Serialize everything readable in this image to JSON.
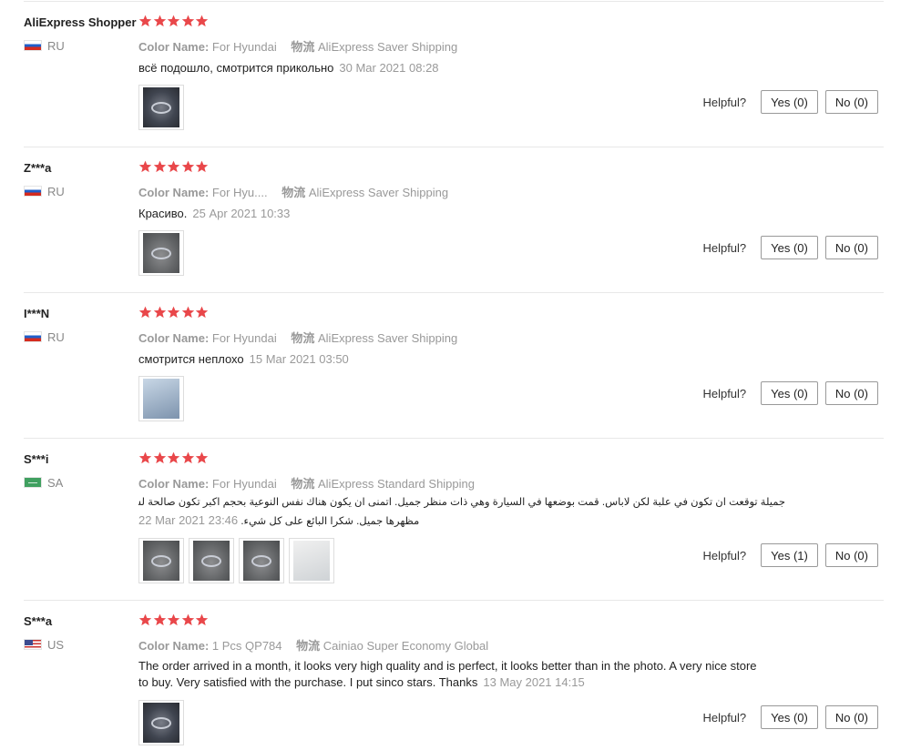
{
  "helpful_label": "Helpful?",
  "colors": {
    "star": "#e9474a",
    "muted": "#999999",
    "divider": "#e8e8e8"
  },
  "reviews": [
    {
      "user": "AliExpress Shopper",
      "country": "RU",
      "rating": 5,
      "color_label": "Color Name:",
      "color_value": "For Hyundai",
      "ship_label": "物流",
      "ship_value": "AliExpress Saver Shipping",
      "text": "всё подошло, смотрится прикольно",
      "date": "30 Mar 2021 08:28",
      "photo_count": 1,
      "yes": "Yes (0)",
      "no": "No (0)"
    },
    {
      "user": "Z***a",
      "country": "RU",
      "rating": 5,
      "color_label": "Color Name:",
      "color_value": "For Hyu....",
      "ship_label": "物流",
      "ship_value": "AliExpress Saver Shipping",
      "text": "Красиво.",
      "date": "25 Apr 2021 10:33",
      "photo_count": 1,
      "yes": "Yes (0)",
      "no": "No (0)"
    },
    {
      "user": "I***N",
      "country": "RU",
      "rating": 5,
      "color_label": "Color Name:",
      "color_value": "For Hyundai",
      "ship_label": "物流",
      "ship_value": "AliExpress Saver Shipping",
      "text": "смотрится неплохо",
      "date": "15 Mar 2021 03:50",
      "photo_count": 1,
      "yes": "Yes (0)",
      "no": "No (0)"
    },
    {
      "user": "S***i",
      "country": "SA",
      "rating": 5,
      "color_label": "Color Name:",
      "color_value": "For Hyundai",
      "ship_label": "物流",
      "ship_value": "AliExpress Standard Shipping",
      "text_line1": "جميلة توقعت ان تكون في علبة لكن لاباس. قمت بوضعها في السيارة وهي ذات منظر جميل. اتمنى ان يكون هناك نفس النوعية بحجم اكبر تكون صالحة لشنطة السيارة سيكون",
      "text_line2": "مظهرها جميل. شكرا البائع على كل شيء.",
      "date": "22 Mar 2021 23:46",
      "photo_count": 4,
      "yes": "Yes (1)",
      "no": "No (0)"
    },
    {
      "user": "S***a",
      "country": "US",
      "rating": 5,
      "color_label": "Color Name:",
      "color_value": "1 Pcs QP784",
      "ship_label": "物流",
      "ship_value": "Cainiao Super Economy Global",
      "text_line1": "The order arrived in a month, it looks very high quality and is perfect, it looks better than in the photo. A very nice store",
      "text_line2": "to buy. Very satisfied with the purchase. I put sinco stars. Thanks",
      "date": "13 May 2021 14:15",
      "photo_count": 1,
      "yes": "Yes (0)",
      "no": "No (0)"
    }
  ]
}
